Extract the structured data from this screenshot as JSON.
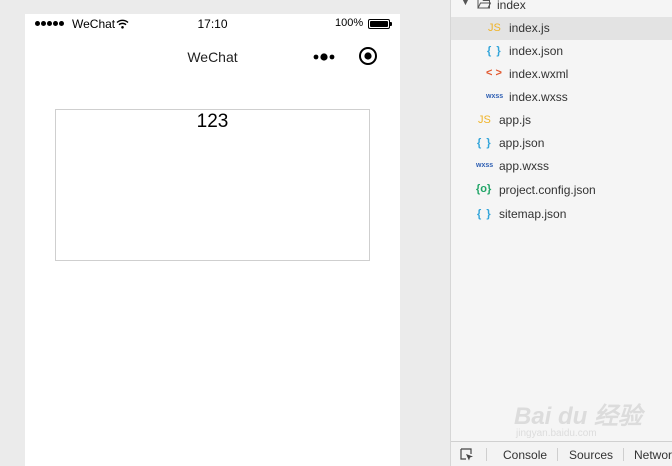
{
  "simulator": {
    "status_bar": {
      "carrier": "WeChat",
      "time": "17:10",
      "battery_percent": "100%",
      "battery_level": 1.0
    },
    "nav_bar": {
      "title": "WeChat"
    },
    "content_text": "123"
  },
  "file_tree": {
    "folder": "index",
    "items": [
      {
        "name": "index.js",
        "icon": "js-file-icon",
        "icon_text": "JS",
        "selected": true
      },
      {
        "name": "index.json",
        "icon": "json-file-icon",
        "icon_text": "{ }"
      },
      {
        "name": "index.wxml",
        "icon": "wxml-file-icon",
        "icon_text": "< >"
      },
      {
        "name": "index.wxss",
        "icon": "wxss-file-icon",
        "icon_text": "wxss"
      },
      {
        "name": "app.js",
        "icon": "js-file-icon",
        "icon_text": "JS"
      },
      {
        "name": "app.json",
        "icon": "json-file-icon",
        "icon_text": "{ }"
      },
      {
        "name": "app.wxss",
        "icon": "wxss-file-icon",
        "icon_text": "wxss"
      },
      {
        "name": "project.config.json",
        "icon": "config-file-icon",
        "icon_text": "{o}"
      },
      {
        "name": "sitemap.json",
        "icon": "json-file-icon",
        "icon_text": "{ }"
      }
    ]
  },
  "devtools": {
    "tabs": [
      "Console",
      "Sources",
      "Network"
    ]
  },
  "watermark": {
    "brand": "Bai du 经验",
    "sub": "jingyan.baidu.com"
  },
  "colors": {
    "js": "#f0b429",
    "json": "#31a4d9",
    "wxml": "#e2572d",
    "wxss": "#2e5fb3",
    "config": "#21a567",
    "selected_row": "#e3e3e3"
  }
}
